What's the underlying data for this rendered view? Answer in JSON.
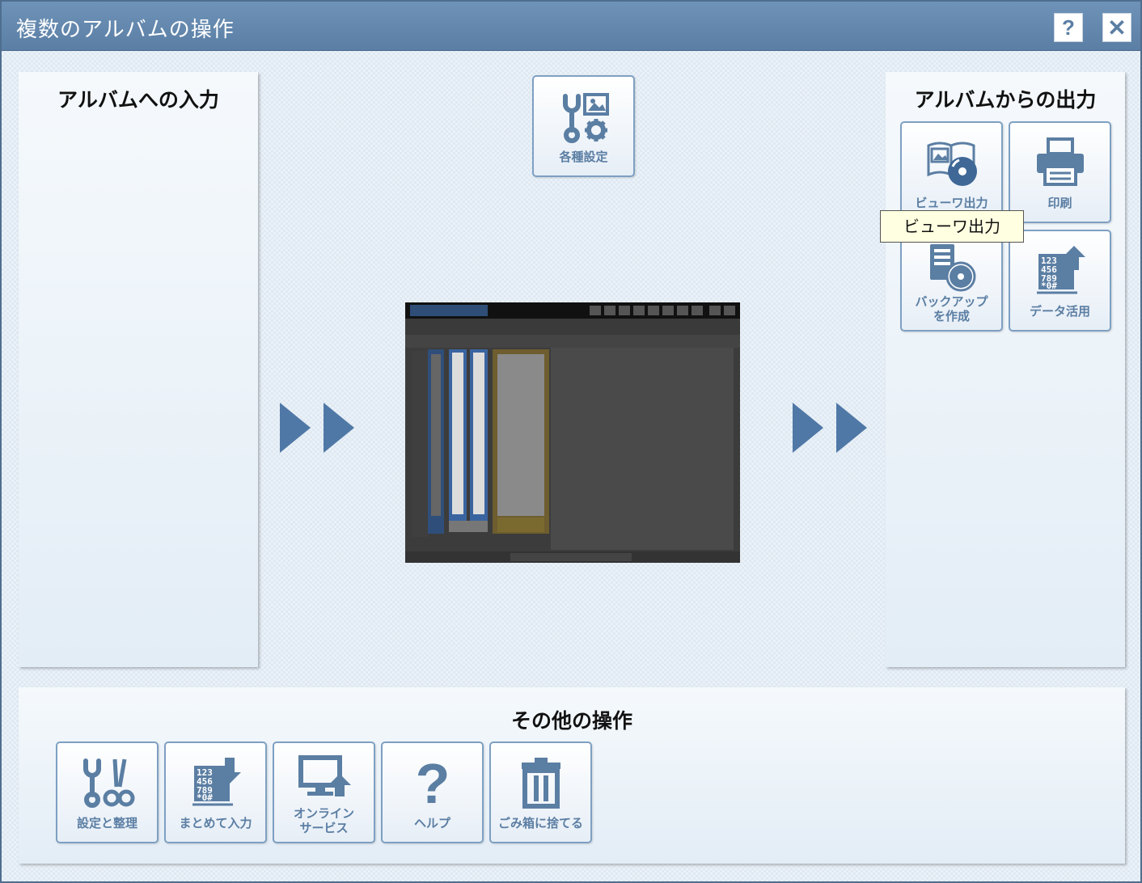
{
  "window": {
    "title": "複数のアルバムの操作",
    "help_label": "?",
    "close_label": "✕"
  },
  "left_panel": {
    "title": "アルバムへの入力"
  },
  "center": {
    "settings_label": "各種設定"
  },
  "right_panel": {
    "title": "アルバムからの出力",
    "buttons": [
      {
        "label": "ビューワ出力",
        "icon": "viewer-output-icon"
      },
      {
        "label": "印刷",
        "icon": "printer-icon"
      },
      {
        "label_line1": "バックアップ",
        "label_line2": "を作成",
        "icon": "backup-icon"
      },
      {
        "label": "データ活用",
        "icon": "data-use-icon"
      }
    ]
  },
  "tooltip": {
    "text": "ビューワ出力"
  },
  "bottom_panel": {
    "title": "その他の操作",
    "buttons": [
      {
        "label": "設定と整理",
        "icon": "tools-icon"
      },
      {
        "label": "まとめて入力",
        "icon": "bulk-input-icon"
      },
      {
        "label_line1": "オンライン",
        "label_line2": "サービス",
        "icon": "online-service-icon"
      },
      {
        "label": "ヘルプ",
        "icon": "help-icon"
      },
      {
        "label": "ごみ箱に捨てる",
        "icon": "trash-icon"
      }
    ]
  },
  "colors": {
    "titlebar": "#5a7ea4",
    "accent": "#5b7ea3",
    "tile_border": "#7ea0c2",
    "tooltip_bg": "#ffffe1"
  }
}
